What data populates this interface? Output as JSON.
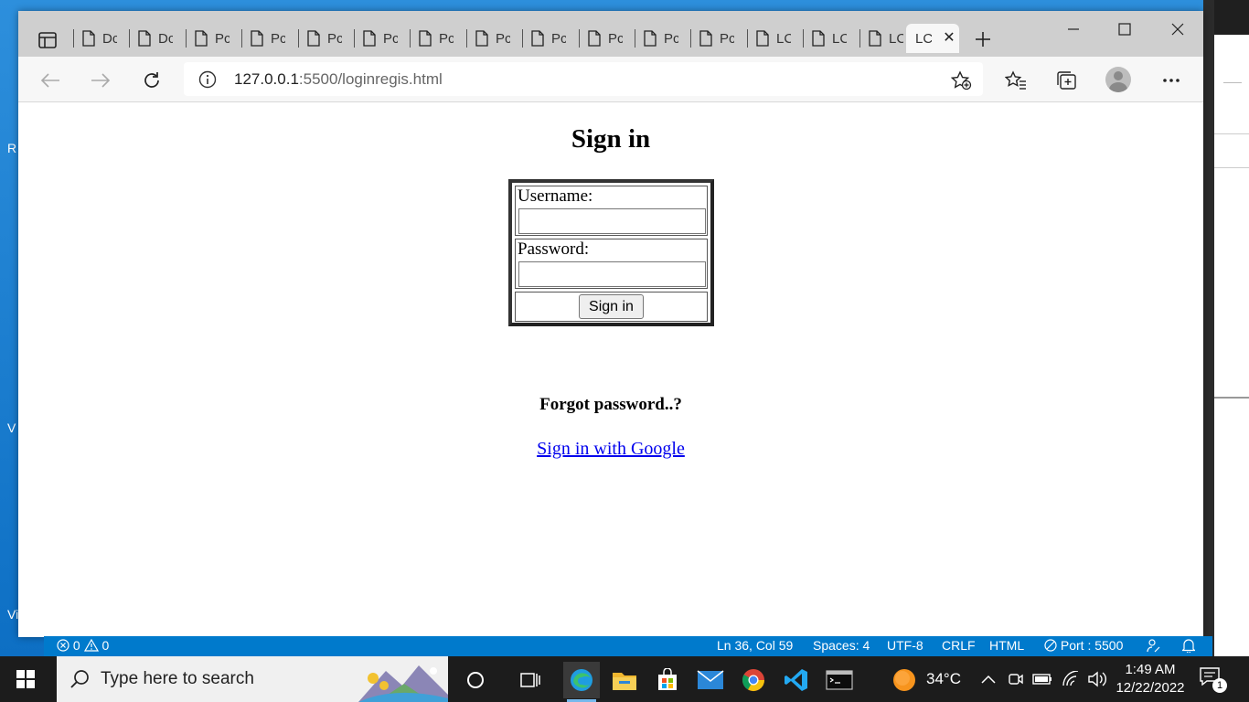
{
  "desktop": {
    "labels": [
      "R",
      "V",
      "Vi"
    ]
  },
  "browser": {
    "tabs": [
      {
        "title": "Dc"
      },
      {
        "title": "Dc"
      },
      {
        "title": "Pc"
      },
      {
        "title": "Pc"
      },
      {
        "title": "Pc"
      },
      {
        "title": "Pc"
      },
      {
        "title": "Pc"
      },
      {
        "title": "Pc"
      },
      {
        "title": "Pc"
      },
      {
        "title": "Pc"
      },
      {
        "title": "Pc"
      },
      {
        "title": "Pc"
      },
      {
        "title": "LC"
      },
      {
        "title": "LC"
      },
      {
        "title": "LC"
      }
    ],
    "active_tab": {
      "title": "LC"
    },
    "address": {
      "host": "127.0.0.1",
      "rest": ":5500/loginregis.html"
    }
  },
  "page": {
    "title": "Sign in",
    "username_label": "Username:",
    "username_value": "",
    "password_label": "Password:",
    "password_value": "",
    "submit_label": "Sign in",
    "forgot_text": "Forgot password..?",
    "google_link": "Sign in with Google"
  },
  "statusbar": {
    "errors": "0",
    "warnings": "0",
    "position": "Ln 36, Col 59",
    "spaces": "Spaces: 4",
    "encoding": "UTF-8",
    "eol": "CRLF",
    "language": "HTML",
    "port": "Port : 5500"
  },
  "taskbar": {
    "search_placeholder": "Type here to search",
    "weather_temp": "34°C",
    "time": "1:49 AM",
    "date": "12/22/2022",
    "notification_count": "1"
  },
  "colors": {
    "statusbar": "#007acc",
    "link": "#0000ee",
    "taskbar": "#1c1c1c",
    "desktop": "#1e88d8"
  }
}
